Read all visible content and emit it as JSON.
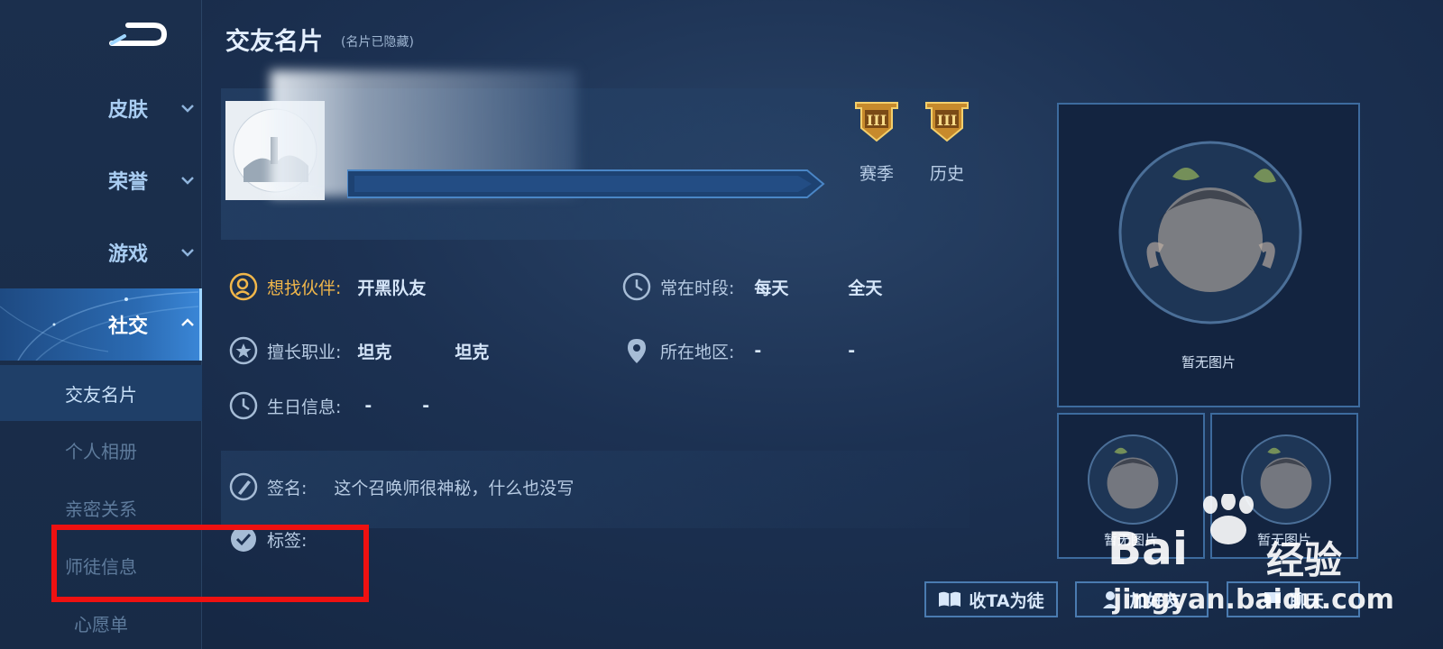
{
  "sidebar": {
    "nav": [
      {
        "label": "皮肤"
      },
      {
        "label": "荣誉"
      },
      {
        "label": "游戏"
      },
      {
        "label": "社交"
      }
    ],
    "sub": [
      {
        "label": "交友名片"
      },
      {
        "label": "个人相册"
      },
      {
        "label": "亲密关系"
      },
      {
        "label": "师徒信息"
      },
      {
        "label": "心愿单"
      }
    ]
  },
  "header": {
    "title": "交友名片",
    "subtitle": "(名片已隐藏)"
  },
  "ranks": [
    {
      "label": "赛季",
      "numeral": "III"
    },
    {
      "label": "历史",
      "numeral": "III"
    }
  ],
  "info": {
    "partner_label": "想找伙伴:",
    "partner_value": "开黑队友",
    "time_label": "常在时段:",
    "time_value1": "每天",
    "time_value2": "全天",
    "role_label": "擅长职业:",
    "role_value1": "坦克",
    "role_value2": "坦克",
    "region_label": "所在地区:",
    "region_value1": "-",
    "region_value2": "-",
    "birthday_label": "生日信息:",
    "birthday_value1": "-",
    "birthday_value2": "-",
    "sign_label": "签名:",
    "sign_value": "这个召唤师很神秘，什么也没写",
    "tag_label": "标签:"
  },
  "photos": {
    "main_caption": "暂无图片",
    "small1_caption": "暂无图片",
    "small2_caption": "暂无图片"
  },
  "actions": {
    "apprentice": "收TA为徒",
    "add_friend": "加好友",
    "chat": "聊天"
  },
  "watermark": {
    "brand": "Bai",
    "brand2": "经验",
    "url": "jingyan.baidu.com"
  },
  "colors": {
    "accent_gold": "#f0b64a",
    "highlight_red": "#ee1111"
  }
}
